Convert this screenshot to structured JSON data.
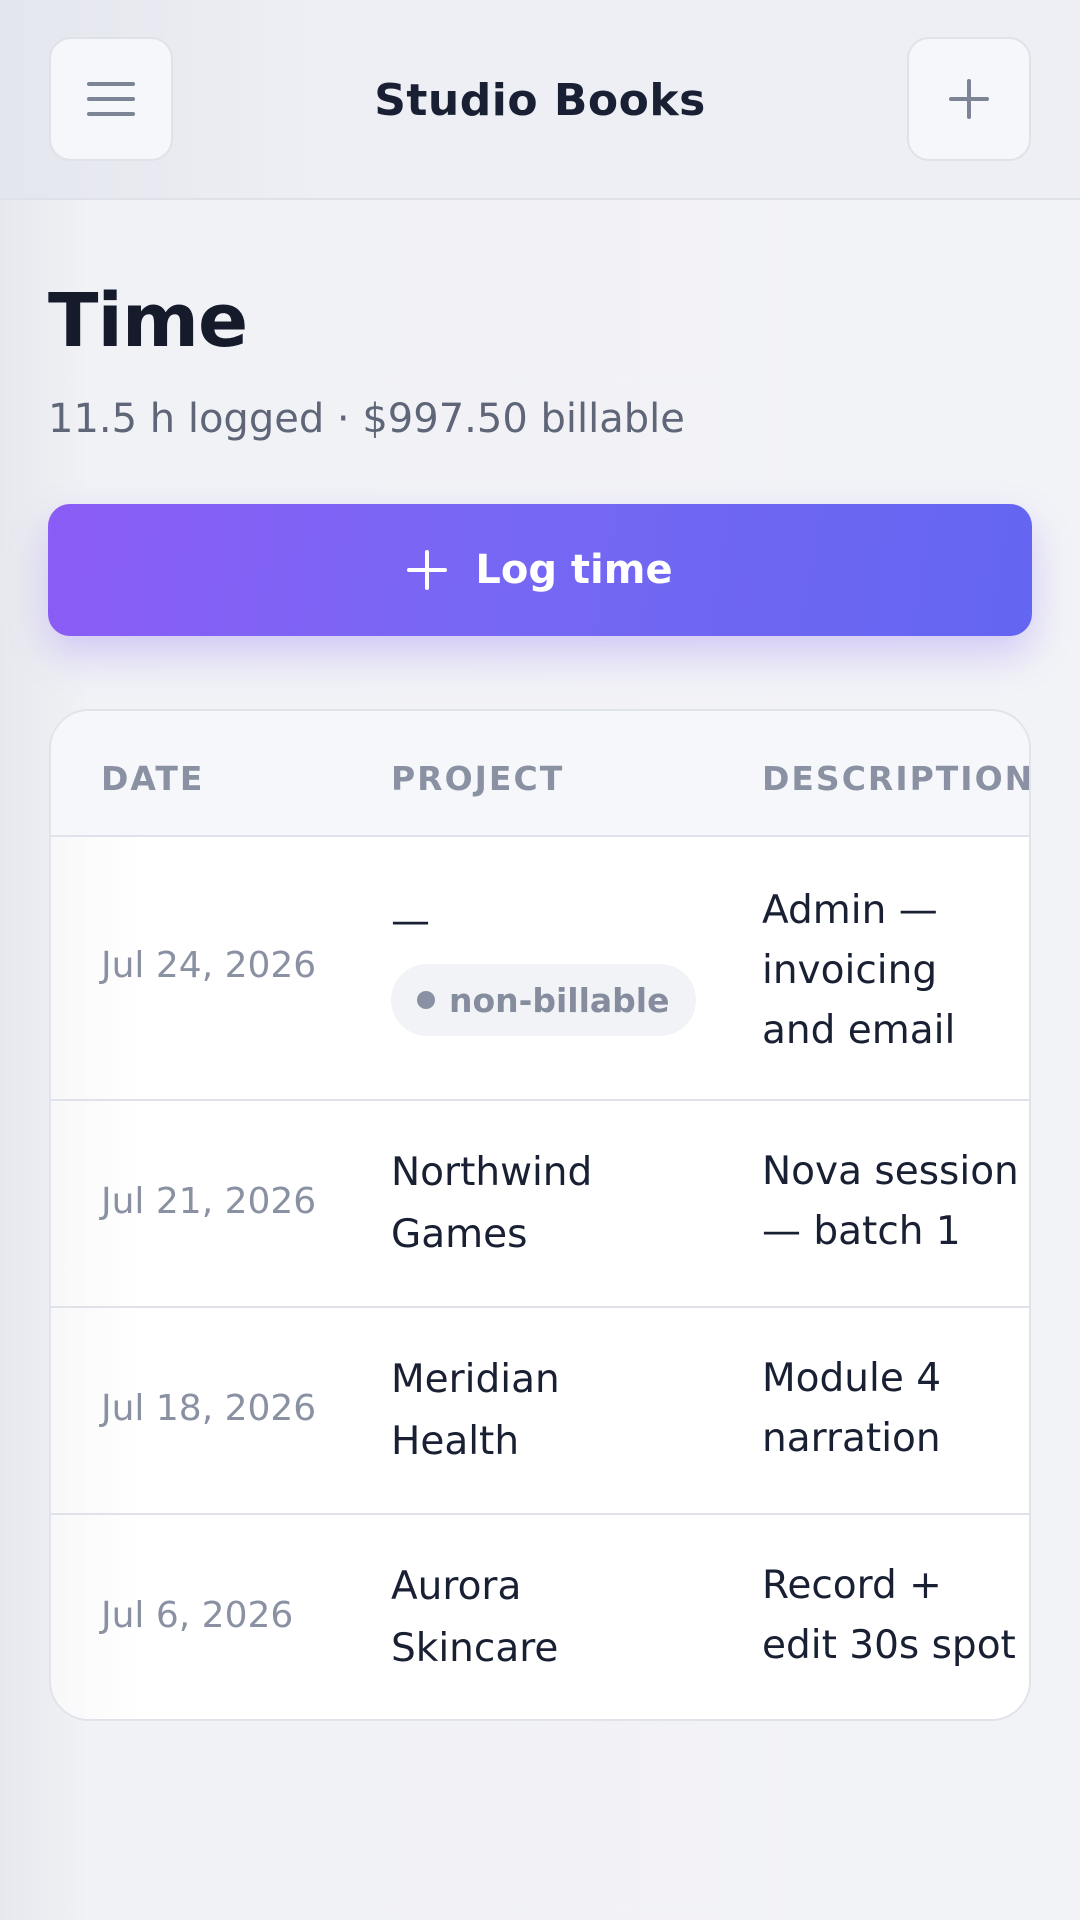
{
  "header": {
    "menu_icon": "hamburger-menu-icon",
    "title": "Studio Books",
    "add_icon": "plus-icon"
  },
  "page": {
    "title": "Time",
    "summary": "11.5 h logged · $997.50 billable"
  },
  "log_button": {
    "icon": "plus-icon",
    "label": "Log time"
  },
  "table": {
    "columns": [
      "DATE",
      "PROJECT",
      "DESCRIPTION"
    ],
    "rows": [
      {
        "date": "Jul 24, 2026",
        "project": "—",
        "badge": "non-billable",
        "description": "Admin — invoicing and email"
      },
      {
        "date": "Jul 21, 2026",
        "project": "Northwind Games",
        "description": "Nova session — batch 1"
      },
      {
        "date": "Jul 18, 2026",
        "project": "Meridian Health",
        "description": "Module 4 narration"
      },
      {
        "date": "Jul 6, 2026",
        "project": "Aurora Skincare",
        "description": "Record + edit 30s spot"
      }
    ]
  },
  "colors": {
    "accent_start": "#8b5cf6",
    "accent_end": "#6366f1",
    "text_primary": "#1a2033",
    "text_muted": "#8a91a2"
  }
}
